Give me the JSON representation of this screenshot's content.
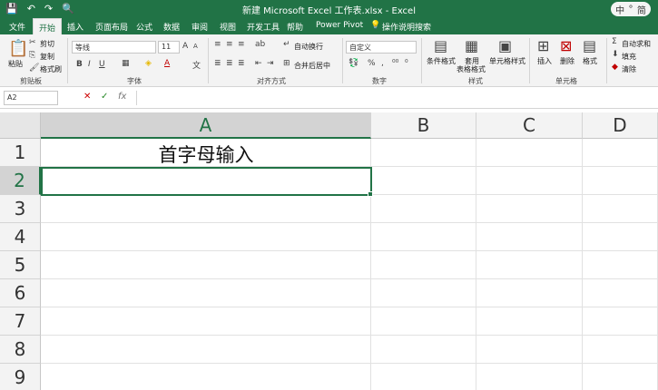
{
  "window": {
    "title": "新建 Microsoft Excel 工作表.xlsx  -  Excel",
    "ime": [
      "中",
      "°",
      "简"
    ]
  },
  "quick_access": {
    "save": "💾",
    "undo": "↶",
    "redo": "↷",
    "preview": "🔍"
  },
  "tabs": [
    "文件",
    "开始",
    "插入",
    "页面布局",
    "公式",
    "数据",
    "审阅",
    "视图",
    "开发工具",
    "帮助",
    "Power Pivot",
    "操作说明搜索"
  ],
  "ribbon": {
    "clipboard": {
      "paste": "粘贴",
      "cut": "剪切",
      "copy": "复制",
      "format_painter": "格式刷",
      "label": "剪贴板"
    },
    "font": {
      "name": "等线",
      "size": "11",
      "grow": "A",
      "shrink": "A",
      "bold": "B",
      "italic": "I",
      "underline": "U",
      "label": "字体"
    },
    "alignment": {
      "wrap": "自动换行",
      "merge": "合并后居中",
      "label": "对齐方式"
    },
    "number": {
      "format": "自定义",
      "percent": "%",
      "comma": ",",
      "label": "数字"
    },
    "styles": {
      "conditional": "条件格式",
      "table": "套用\n表格格式",
      "cell_styles": "单元格样式",
      "label": "样式"
    },
    "cells": {
      "insert": "插入",
      "delete": "删除",
      "format": "格式",
      "label": "单元格"
    },
    "editing": {
      "autosum": "自动求和",
      "fill": "填充",
      "clear": "清除"
    }
  },
  "formula_bar": {
    "name_box": "A2",
    "cancel": "✕",
    "enter": "✓",
    "fx": "fx",
    "value": ""
  },
  "sheet": {
    "columns": [
      "A",
      "B",
      "C",
      "D"
    ],
    "rows": [
      "1",
      "2",
      "3",
      "4",
      "5",
      "6",
      "7",
      "8",
      "9"
    ],
    "cells": {
      "A1": "首字母输入"
    },
    "active_cell": "A2"
  },
  "colors": {
    "accent": "#217346"
  }
}
